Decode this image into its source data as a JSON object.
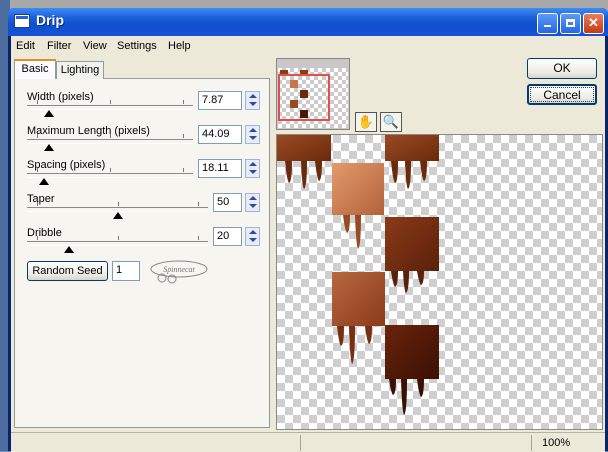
{
  "window": {
    "title": "Drip"
  },
  "menu": [
    "Edit",
    "Filter",
    "View",
    "Settings",
    "Help"
  ],
  "tabs": [
    {
      "label": "Basic",
      "active": true
    },
    {
      "label": "Lighting",
      "active": false
    }
  ],
  "controls": {
    "width": {
      "label": "Width (pixels)",
      "value": "7.87",
      "level": 0.08
    },
    "max_length": {
      "label": "Maximum Length (pixels)",
      "value": "44.09",
      "level": 0.08
    },
    "spacing": {
      "label": "Spacing (pixels)",
      "value": "18.11",
      "level": 0.05
    },
    "taper": {
      "label": "Taper",
      "value": "50",
      "level": 0.5
    },
    "dribble": {
      "label": "Dribble",
      "value": "20",
      "level": 0.2
    }
  },
  "random_seed": {
    "label": "Random Seed",
    "value": "1"
  },
  "buttons": {
    "ok": "OK",
    "cancel": "Cancel"
  },
  "status": {
    "zoom": "100%"
  },
  "colors": {
    "title_blue": "#1d5fd8",
    "choc_dark": "#5a200a",
    "choc_mid": "#8a3b18",
    "choc_light": "#c9764a"
  }
}
